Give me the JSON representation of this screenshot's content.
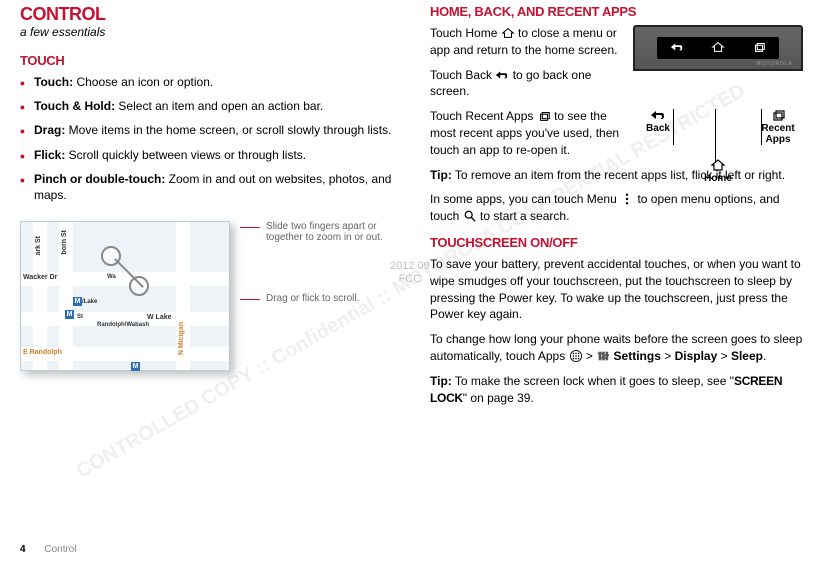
{
  "left": {
    "title": "CONTROL",
    "subtitle": "a few essentials",
    "section_touch": "TOUCH",
    "bullets": [
      {
        "term": "Touch:",
        "desc": " Choose an icon or option."
      },
      {
        "term": "Touch & Hold:",
        "desc": " Select an item and open an action bar."
      },
      {
        "term": "Drag:",
        "desc": " Move items in the home screen, or scroll slowly through lists."
      },
      {
        "term": "Flick:",
        "desc": " Scroll quickly between views or through lists."
      },
      {
        "term": "Pinch or double-touch:",
        "desc": " Zoom in and out on websites, photos, and maps."
      }
    ],
    "map": {
      "streets": {
        "wacker": "Wacker Dr",
        "randolph": "E Randolph",
        "wlake": "W Lake",
        "dearborn": "born St",
        "clark": "ark St",
        "nmich": "N Micigan",
        "stop1": "le/Lake",
        "stop2": "Randolph/Wabash",
        "stop3": "St",
        "stop4": "Wa"
      },
      "callout1": "Slide two fingers apart or together to zoom in or out.",
      "callout2": "Drag or flick to scroll."
    }
  },
  "right": {
    "section_home": "HOME, BACK, AND RECENT APPS",
    "home_p1a": "Touch Home ",
    "home_p1b": " to close a menu or app and return to the home screen.",
    "back_p1a": "Touch Back ",
    "back_p1b": " to go back one screen.",
    "recent_p1a": "Touch Recent Apps ",
    "recent_p1b": " to see the most recent apps you've used, then touch an app to re-open it.",
    "tip1_label": "Tip:",
    "tip1_body": " To remove an item from the recent apps list, flick it left or right.",
    "menu_p1a": "In some apps, you can touch Menu ",
    "menu_p1b": " to open menu options, and touch ",
    "menu_p1c": " to start a search.",
    "section_ts": "TOUCHSCREEN ON/OFF",
    "ts_p1": "To save your battery, prevent accidental touches, or when you want to wipe smudges off your touchscreen, put the touchscreen to sleep by pressing the Power key. To wake up the touchscreen, just press the Power key again.",
    "ts_p2a": "To change how long your phone waits before the screen goes to sleep automatically, touch Apps ",
    "ts_p2b": " > ",
    "ts_p2c": " Settings",
    "ts_p2d": " > ",
    "ts_p2e": "Display",
    "ts_p2f": " > ",
    "ts_p2g": "Sleep",
    "ts_p2h": ".",
    "tip2_label": "Tip:",
    "tip2_body_a": " To make the screen lock when it goes to sleep, see \"",
    "tip2_body_b": "SCREEN LOCK",
    "tip2_body_c": "\" on page 39.",
    "device": {
      "back_label": "Back",
      "home_label": "Home",
      "recent_label": "Recent Apps",
      "brand": "MOTOROLA"
    }
  },
  "footer": {
    "page_num": "4",
    "section": "Control"
  },
  "fcc": {
    "line1": "2012.09",
    "line2": "FCC"
  },
  "watermark": "CONTROLLED COPY :: Confidential :: MOTOROLA CONFIDENTIAL RESTRICTED"
}
